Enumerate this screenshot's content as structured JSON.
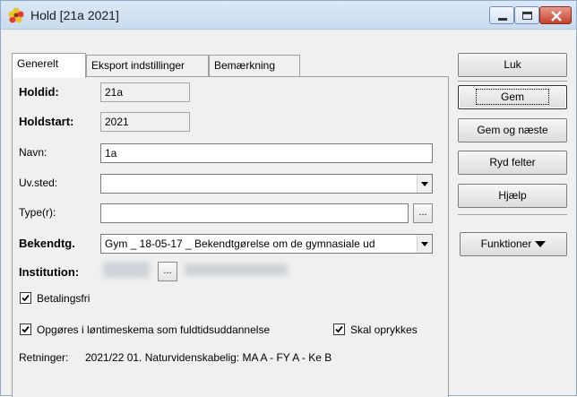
{
  "window": {
    "title": "Hold [21a 2021]"
  },
  "tabs": [
    {
      "label": "Generelt",
      "active": true
    },
    {
      "label": "Eksport indstillinger",
      "active": false
    },
    {
      "label": "Bemærkning",
      "active": false
    }
  ],
  "form": {
    "holdid": {
      "label": "Holdid:",
      "value": "21a"
    },
    "holdstart": {
      "label": "Holdstart:",
      "value": "2021"
    },
    "navn": {
      "label": "Navn:",
      "value": "1a"
    },
    "uvsted": {
      "label": "Uv.sted:",
      "value": ""
    },
    "typer": {
      "label": "Type(r):",
      "value": "",
      "button": "..."
    },
    "bekendtg": {
      "label": "Bekendtg.",
      "value": "Gym _ 18-05-17 _ Bekendtgørelse om de gymnasiale ud"
    },
    "institution": {
      "label": "Institution:",
      "button": "..."
    },
    "betalingsfri": {
      "label": "Betalingsfri",
      "checked": true
    },
    "opgoeres": {
      "label": "Opgøres i løntimeskema som fuldtidsuddannelse",
      "checked": true
    },
    "skal_oprykkes": {
      "label": "Skal oprykkes",
      "checked": true
    },
    "retninger": {
      "label": "Retninger:",
      "value": "2021/22 01. Naturvidenskabelig: MA A - FY A - Ke B"
    }
  },
  "buttons": {
    "luk": "Luk",
    "gem": "Gem",
    "gem_naeste": "Gem og næste",
    "ryd": "Ryd felter",
    "hjaelp": "Hjælp",
    "funktioner": "Funktioner"
  },
  "colors": {
    "accent_close": "#c7412b",
    "titlebar": "#dbe8f6"
  }
}
